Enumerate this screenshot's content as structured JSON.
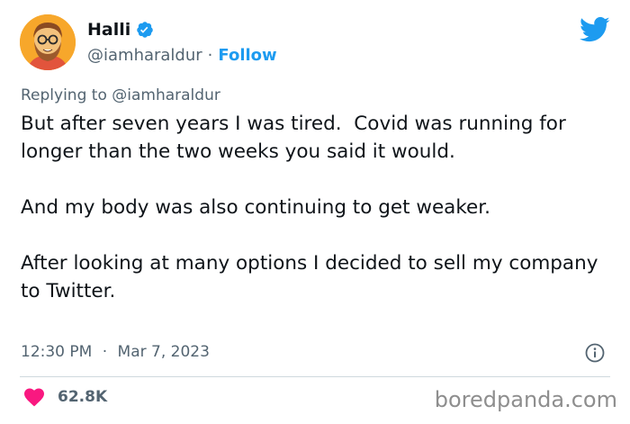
{
  "author": {
    "display_name": "Halli",
    "handle": "@iamharaldur",
    "separator": "·",
    "follow_label": "Follow",
    "avatar_icon": "cartoon-avatar"
  },
  "reply": {
    "prefix": "Replying to ",
    "handle": "@iamharaldur"
  },
  "tweet": {
    "text": "But after seven years I was tired.  Covid was running for longer than the two weeks you said it would.\n\nAnd my body was also continuing to get weaker.\n\nAfter looking at many options I decided to sell my company to Twitter.",
    "time": "12:30 PM",
    "separator": "·",
    "date": "Mar 7, 2023"
  },
  "engagement": {
    "likes": "62.8K"
  },
  "watermark": "boredpanda.com",
  "colors": {
    "accent": "#1d9bf0",
    "like": "#f91880",
    "text": "#0f1419",
    "secondary": "#536471"
  },
  "icons": [
    "verified-badge-icon",
    "twitter-bird-icon",
    "info-icon",
    "heart-icon"
  ]
}
